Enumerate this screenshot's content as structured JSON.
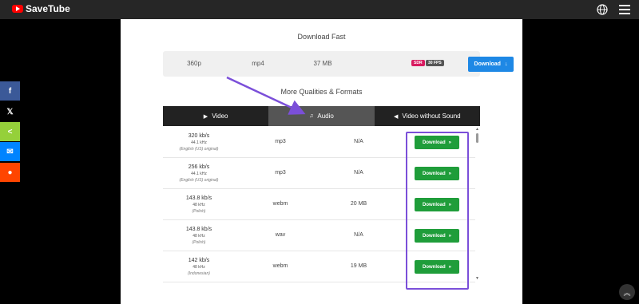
{
  "app": {
    "name": "SaveTube"
  },
  "icons": {
    "logo": "youtube-play-icon",
    "globe": "globe-icon",
    "menu": "hamburger-menu-icon",
    "scroll_top": "chevron-double-up-icon"
  },
  "download_fast": {
    "title": "Download Fast",
    "resolution": "360p",
    "format": "mp4",
    "size": "37 MB",
    "badge_sdr": "SDR",
    "badge_fps": "30 FPS",
    "button_label": "Download"
  },
  "more_title": "More Qualities & Formats",
  "tabs": [
    {
      "label": "Video",
      "icon": "play-circle-icon",
      "active": false
    },
    {
      "label": "Audio",
      "icon": "music-note-icon",
      "active": true
    },
    {
      "label": "Video without Sound",
      "icon": "volume-mute-icon",
      "active": false
    }
  ],
  "rows": [
    {
      "bitrate": "320 kb/s",
      "sample_rate": "44.1 kHz",
      "language": "(English (US) original)",
      "format": "mp3",
      "size": "N/A",
      "button": "Download"
    },
    {
      "bitrate": "256 kb/s",
      "sample_rate": "44.1 kHz",
      "language": "(English (US) original)",
      "format": "mp3",
      "size": "N/A",
      "button": "Download"
    },
    {
      "bitrate": "143.8 kb/s",
      "sample_rate": "48 kHz",
      "language": "(Polish)",
      "format": "webm",
      "size": "20 MB",
      "button": "Download"
    },
    {
      "bitrate": "143.8 kb/s",
      "sample_rate": "48 kHz",
      "language": "(Polish)",
      "format": "wav",
      "size": "N/A",
      "button": "Download"
    },
    {
      "bitrate": "142 kb/s",
      "sample_rate": "48 kHz",
      "language": "(Indonesian)",
      "format": "webm",
      "size": "19 MB",
      "button": "Download"
    }
  ],
  "share": [
    {
      "network": "facebook",
      "glyph": "f"
    },
    {
      "network": "x",
      "glyph": "𝕏"
    },
    {
      "network": "sharethis",
      "glyph": "<"
    },
    {
      "network": "messenger",
      "glyph": "✉"
    },
    {
      "network": "reddit",
      "glyph": "●"
    }
  ],
  "colors": {
    "accent_blue": "#1e88e5",
    "download_green": "#1f9d3a",
    "annotation_purple": "#7b4fd9",
    "sdr_badge": "#d81b60"
  }
}
